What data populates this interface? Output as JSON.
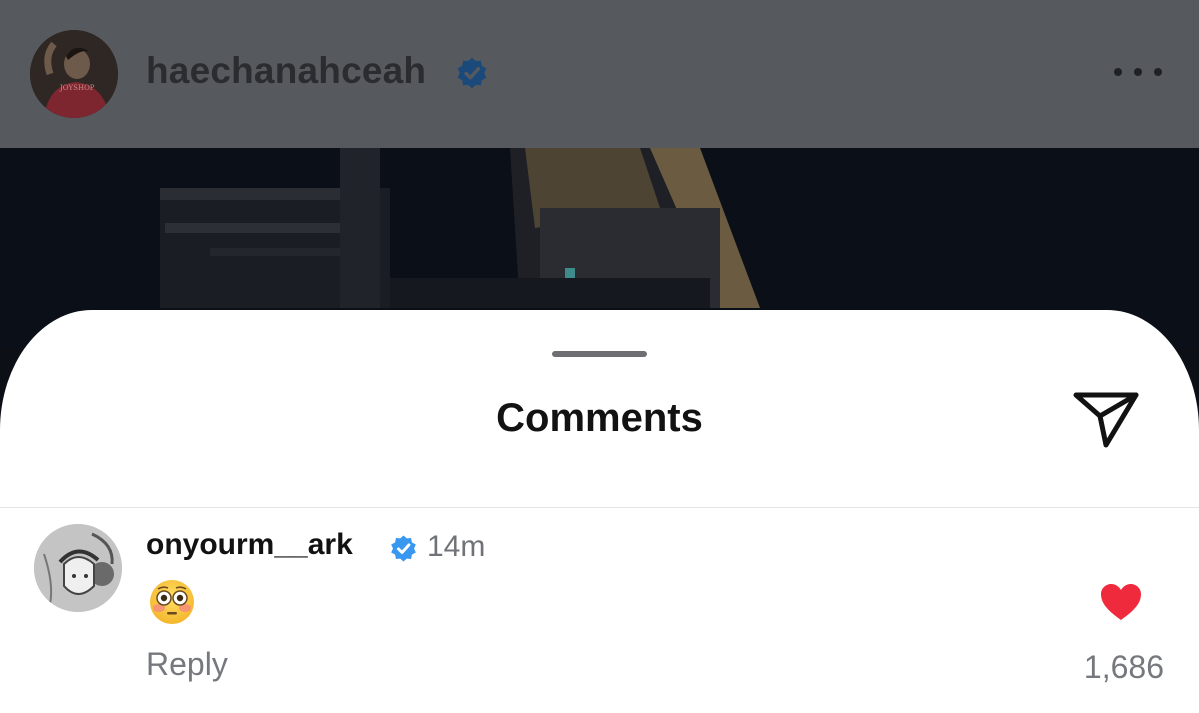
{
  "post_header": {
    "username": "haechanahceah",
    "verified_icon": "verified-badge-icon",
    "more_icon": "more-options-icon",
    "avatar_shirt_text": "JOYSHOP"
  },
  "comments_sheet": {
    "title": "Comments",
    "share_icon": "send-icon"
  },
  "comments": [
    {
      "username": "onyourm__ark",
      "verified": true,
      "time": "14m",
      "text": "😳",
      "reply_label": "Reply",
      "liked": true,
      "like_count": "1,686"
    }
  ],
  "colors": {
    "verified_blue": "#3897f0",
    "like_red": "#ee2a3c",
    "header_dim": "#565a5f"
  }
}
